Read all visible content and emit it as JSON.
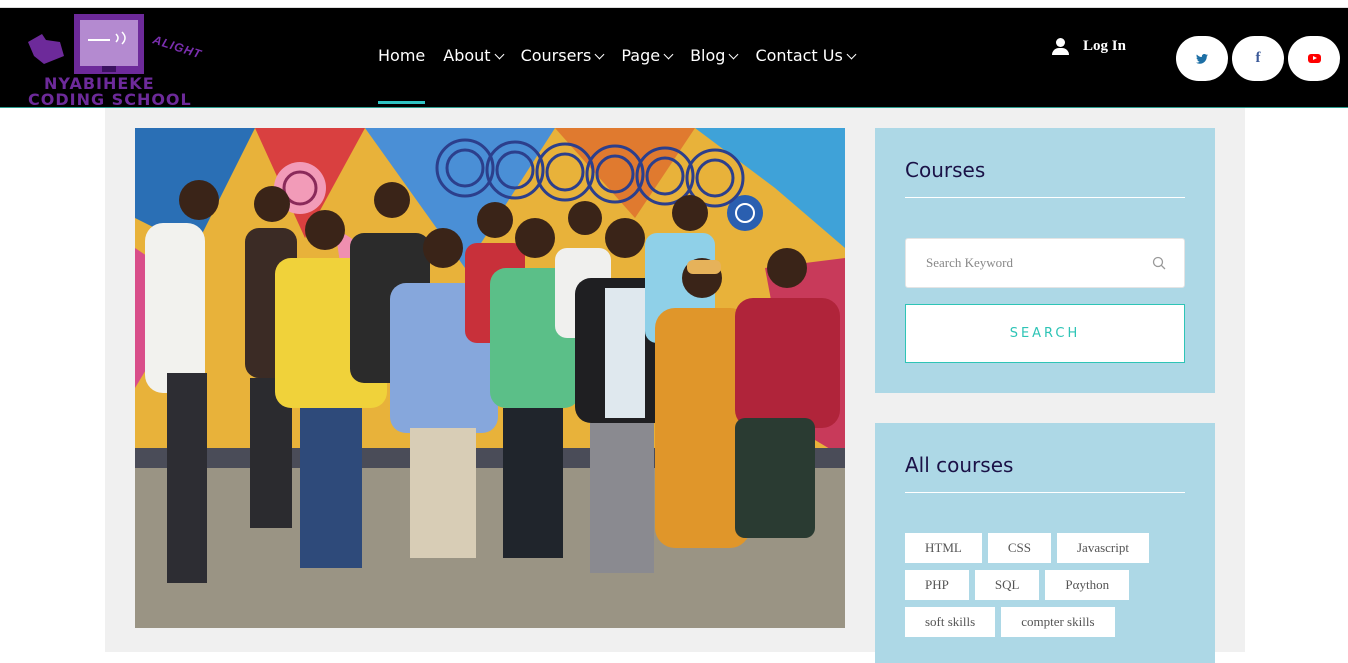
{
  "logo": {
    "line1": "NYABIHEKE",
    "line2": "CODING SCHOOL",
    "tagline": "ALIGHT"
  },
  "nav": {
    "items": [
      {
        "label": "Home",
        "active": true,
        "dropdown": false
      },
      {
        "label": "About",
        "dropdown": true
      },
      {
        "label": "Coursers",
        "dropdown": true
      },
      {
        "label": "Page",
        "dropdown": true
      },
      {
        "label": "Blog",
        "dropdown": true
      },
      {
        "label": "Contact Us",
        "dropdown": true
      }
    ],
    "login_label": "Log In",
    "social": {
      "twitter_icon": "twitter-icon",
      "facebook_glyph": "f",
      "youtube_icon": "youtube-icon"
    }
  },
  "colors": {
    "header_bg": "#000000",
    "accent": "#2ec4b6",
    "sidebar_bg": "#add8e6",
    "heading": "#1b1247"
  },
  "sidebar": {
    "courses_widget": {
      "title": "Courses",
      "search_placeholder": "Search Keyword",
      "search_button": "SEARCH"
    },
    "all_courses_widget": {
      "title": "All courses",
      "tags": [
        "HTML",
        "CSS",
        "Javascript",
        "PHP",
        "SQL",
        "Pαython",
        "soft skills",
        "compter skills"
      ]
    }
  }
}
